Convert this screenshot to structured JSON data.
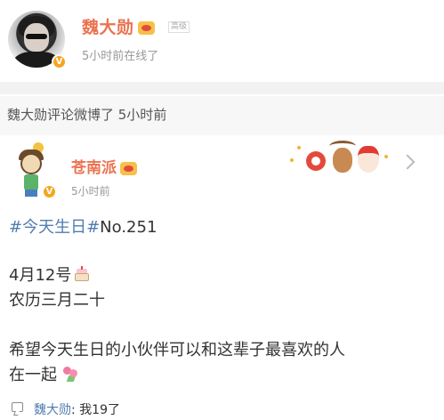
{
  "post_header": {
    "user_name": "魏大勋",
    "small_tag": "高级",
    "status": "5小时前在线了",
    "verified_badge": "V"
  },
  "comment_notice": {
    "text": "魏大勋评论微博了 5小时前"
  },
  "original_post": {
    "author": "苍南派",
    "time": "5小时前",
    "verified_badge": "V",
    "topic": "#今天生日#",
    "topic_suffix": "No.251",
    "line_date": "4月12号",
    "line_lunar": "农历三月二十",
    "line_wish_1": "希望今天生日的小伙伴可以和这辈子最喜欢的人",
    "line_wish_2": "在一起"
  },
  "reply": {
    "name": "魏大勋",
    "separator": ":",
    "text": " 我19了"
  },
  "colors": {
    "accent_name": "#eb7350",
    "topic_link": "#507daf",
    "muted": "#999999"
  }
}
